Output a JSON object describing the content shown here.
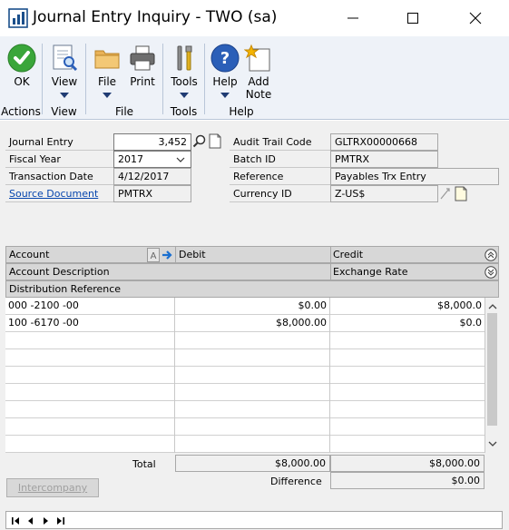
{
  "window": {
    "title": "Journal Entry Inquiry  -  TWO (sa)"
  },
  "ribbon": {
    "ok_label": "OK",
    "view_label": "View",
    "file_label": "File",
    "print_label": "Print",
    "tools_label": "Tools",
    "help_label": "Help",
    "add_note_label_1": "Add",
    "add_note_label_2": "Note",
    "groups": {
      "actions": "Actions",
      "view": "View",
      "file": "File",
      "tools": "Tools",
      "help": "Help"
    }
  },
  "header": {
    "journal_entry_label": "Journal Entry",
    "journal_entry_value": "3,452",
    "fiscal_year_label": "Fiscal Year",
    "fiscal_year_value": "2017",
    "transaction_date_label": "Transaction Date",
    "transaction_date_value": "4/12/2017",
    "source_document_label": "Source Document",
    "source_document_value": "PMTRX",
    "audit_trail_label": "Audit Trail Code",
    "audit_trail_value": "GLTRX00000668",
    "batch_id_label": "Batch ID",
    "batch_id_value": "PMTRX",
    "reference_label": "Reference",
    "reference_value": "Payables Trx Entry",
    "currency_id_label": "Currency ID",
    "currency_id_value": "Z-US$"
  },
  "grid": {
    "col_account": "Account",
    "col_debit": "Debit",
    "col_credit": "Credit",
    "col_account_description": "Account Description",
    "col_exchange_rate": "Exchange Rate",
    "col_distribution_reference": "Distribution Reference",
    "rows": [
      {
        "account": "000 -2100 -00",
        "debit": "$0.00",
        "credit": "$8,000.0"
      },
      {
        "account": "100 -6170 -00",
        "debit": "$8,000.00",
        "credit": "$0.0"
      }
    ]
  },
  "totals": {
    "total_label": "Total",
    "total_debit": "$8,000.00",
    "total_credit": "$8,000.00",
    "difference_label": "Difference",
    "difference_value": "$0.00"
  },
  "buttons": {
    "intercompany": "Intercompany"
  },
  "colors": {
    "ribbon_bg": "#eef2f8",
    "form_bg": "#f0f0f0",
    "link": "#0645ad",
    "ok_green": "#3aa63a",
    "help_blue": "#2b5fb8"
  }
}
